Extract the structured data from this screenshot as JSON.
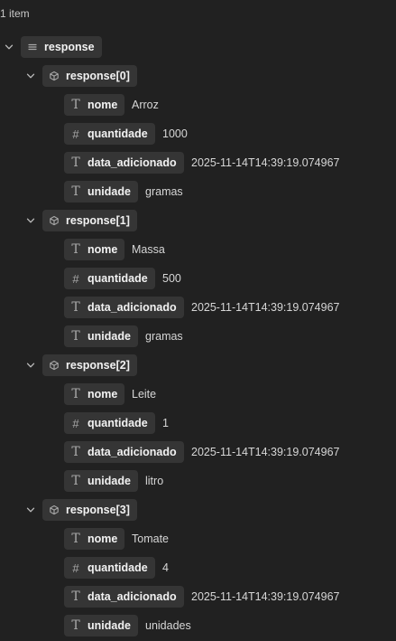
{
  "summary": {
    "count_label": "1 item"
  },
  "tree": {
    "root_key": "response",
    "items": [
      {
        "key": "response[0]",
        "fields": [
          {
            "type": "text",
            "type_icon": "T",
            "key": "nome",
            "value": "Arroz"
          },
          {
            "type": "number",
            "type_icon": "#",
            "key": "quantidade",
            "value": "1000"
          },
          {
            "type": "text",
            "type_icon": "T",
            "key": "data_adicionado",
            "value": "2025-11-14T14:39:19.074967"
          },
          {
            "type": "text",
            "type_icon": "T",
            "key": "unidade",
            "value": "gramas"
          }
        ]
      },
      {
        "key": "response[1]",
        "fields": [
          {
            "type": "text",
            "type_icon": "T",
            "key": "nome",
            "value": "Massa"
          },
          {
            "type": "number",
            "type_icon": "#",
            "key": "quantidade",
            "value": "500"
          },
          {
            "type": "text",
            "type_icon": "T",
            "key": "data_adicionado",
            "value": "2025-11-14T14:39:19.074967"
          },
          {
            "type": "text",
            "type_icon": "T",
            "key": "unidade",
            "value": "gramas"
          }
        ]
      },
      {
        "key": "response[2]",
        "fields": [
          {
            "type": "text",
            "type_icon": "T",
            "key": "nome",
            "value": "Leite"
          },
          {
            "type": "number",
            "type_icon": "#",
            "key": "quantidade",
            "value": "1"
          },
          {
            "type": "text",
            "type_icon": "T",
            "key": "data_adicionado",
            "value": "2025-11-14T14:39:19.074967"
          },
          {
            "type": "text",
            "type_icon": "T",
            "key": "unidade",
            "value": "litro"
          }
        ]
      },
      {
        "key": "response[3]",
        "fields": [
          {
            "type": "text",
            "type_icon": "T",
            "key": "nome",
            "value": "Tomate"
          },
          {
            "type": "number",
            "type_icon": "#",
            "key": "quantidade",
            "value": "4"
          },
          {
            "type": "text",
            "type_icon": "T",
            "key": "data_adicionado",
            "value": "2025-11-14T14:39:19.074967"
          },
          {
            "type": "text",
            "type_icon": "T",
            "key": "unidade",
            "value": "unidades"
          }
        ]
      }
    ]
  },
  "icons": {
    "expanded": "chevron-down-icon",
    "array": "list-icon",
    "object": "cube-icon",
    "text": "text-type-icon",
    "number": "hash-icon"
  },
  "colors": {
    "background": "#212121",
    "pill": "#353535",
    "key_text": "#f2f2f2",
    "value_text": "#d6d6d6",
    "icon": "#a9a9a9"
  }
}
